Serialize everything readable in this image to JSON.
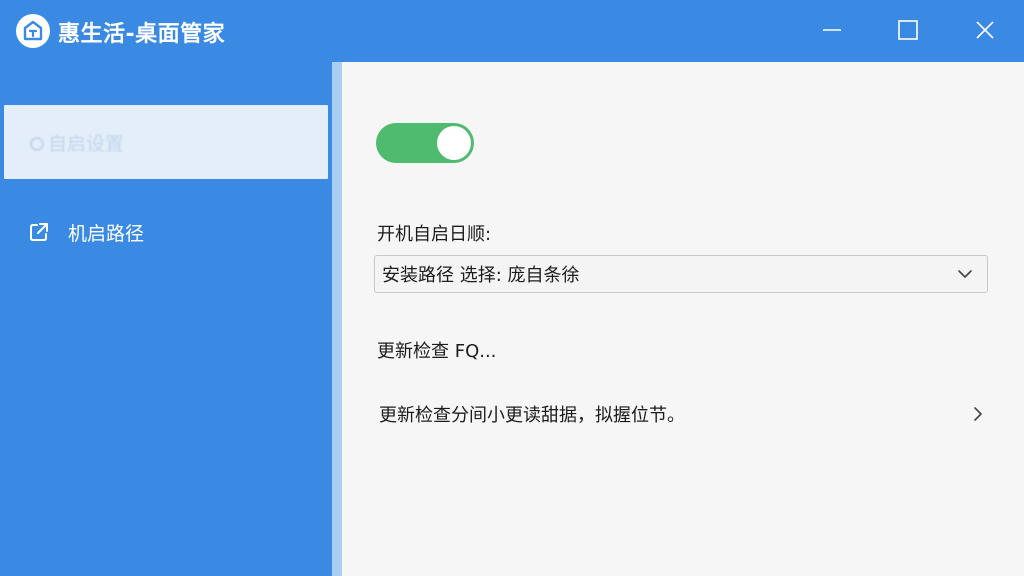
{
  "window": {
    "title": "惠生活-桌面管家",
    "logo_icon": "house-shield-icon",
    "controls": [
      "minimize-icon",
      "maximize-icon",
      "close-icon"
    ]
  },
  "sidebar": {
    "items": [
      {
        "label": "自启设置",
        "icon": "radio-dot-icon",
        "active": true
      },
      {
        "label": "机启路径",
        "icon": "external-link-icon",
        "active": false
      }
    ]
  },
  "main": {
    "toggle": {
      "on": true
    },
    "field_label": "开机自启日顺:",
    "select": {
      "value": "安装路径 选择: 庞自条徐"
    },
    "status_text": "更新检查 FQ...",
    "link_row": {
      "label": "更新检查分间小更读甜据，拟握位节。"
    }
  },
  "colors": {
    "accent": "#3a8ae3",
    "toggle_on": "#4fbb6f",
    "content_bg": "#f6f6f6",
    "active_item_bg": "#e4eefa"
  }
}
